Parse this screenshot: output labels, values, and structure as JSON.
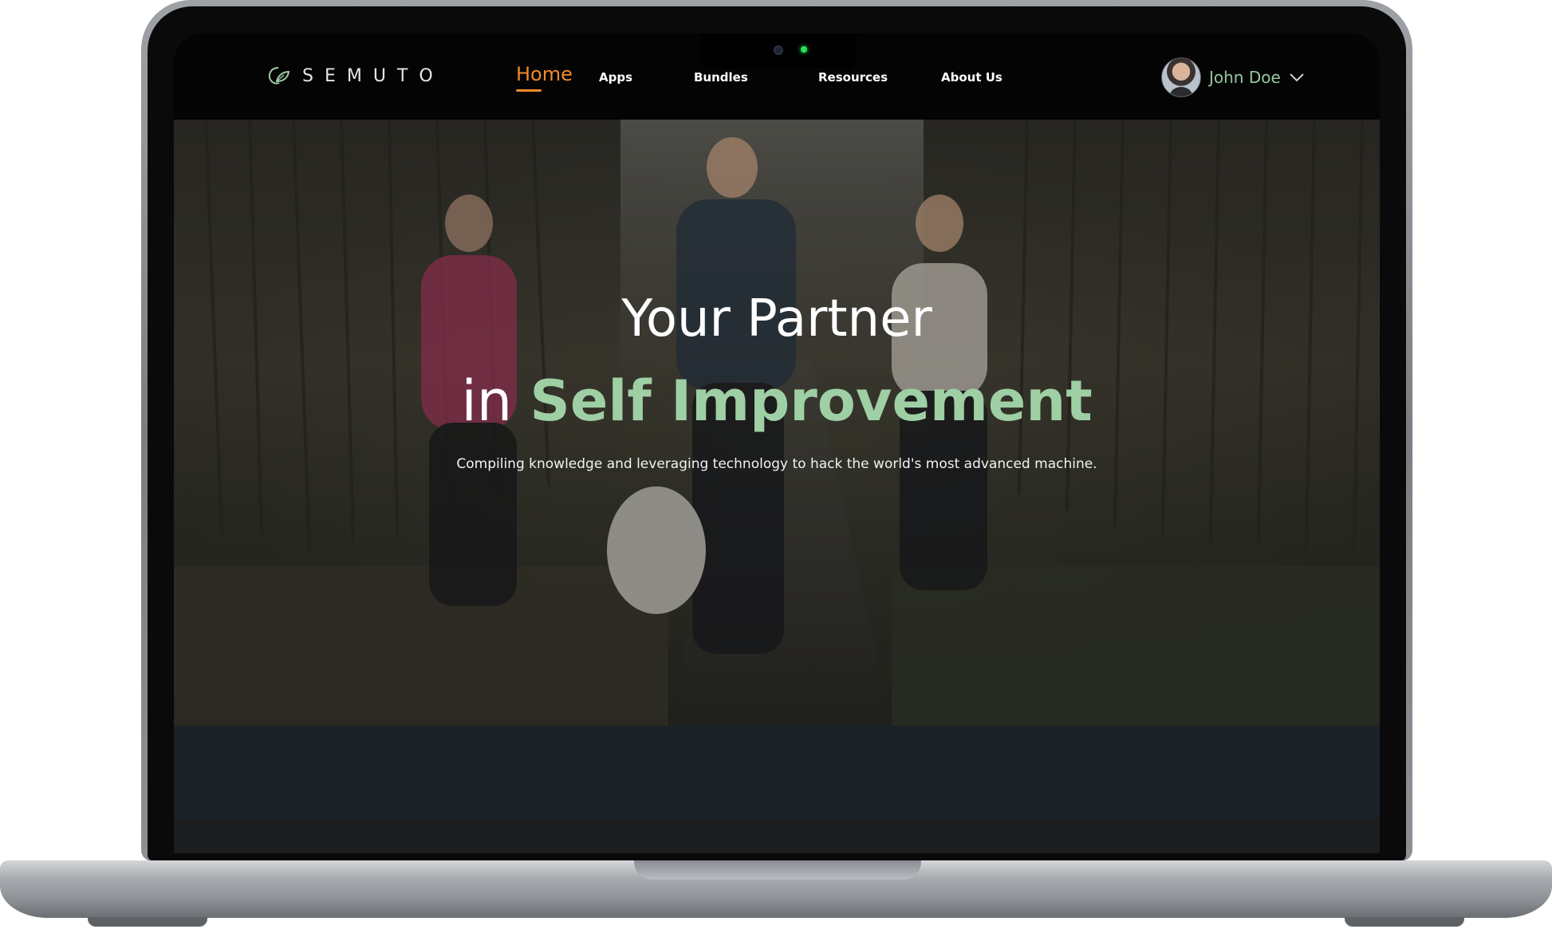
{
  "brand": {
    "name": "SEMUTO",
    "accent": "#f08a2c",
    "highlight": "#9fcfa4"
  },
  "nav": {
    "items": [
      {
        "label": "Home",
        "active": true
      },
      {
        "label": "Apps"
      },
      {
        "label": "Bundles"
      },
      {
        "label": "Resources"
      },
      {
        "label": "About Us"
      }
    ]
  },
  "user": {
    "name": "John Doe"
  },
  "hero": {
    "title_line1": "Your Partner",
    "title_line2_prefix": "in ",
    "title_line2_highlight": "Self Improvement",
    "subtitle": "Compiling knowledge and leveraging technology to hack the world's most advanced machine."
  }
}
